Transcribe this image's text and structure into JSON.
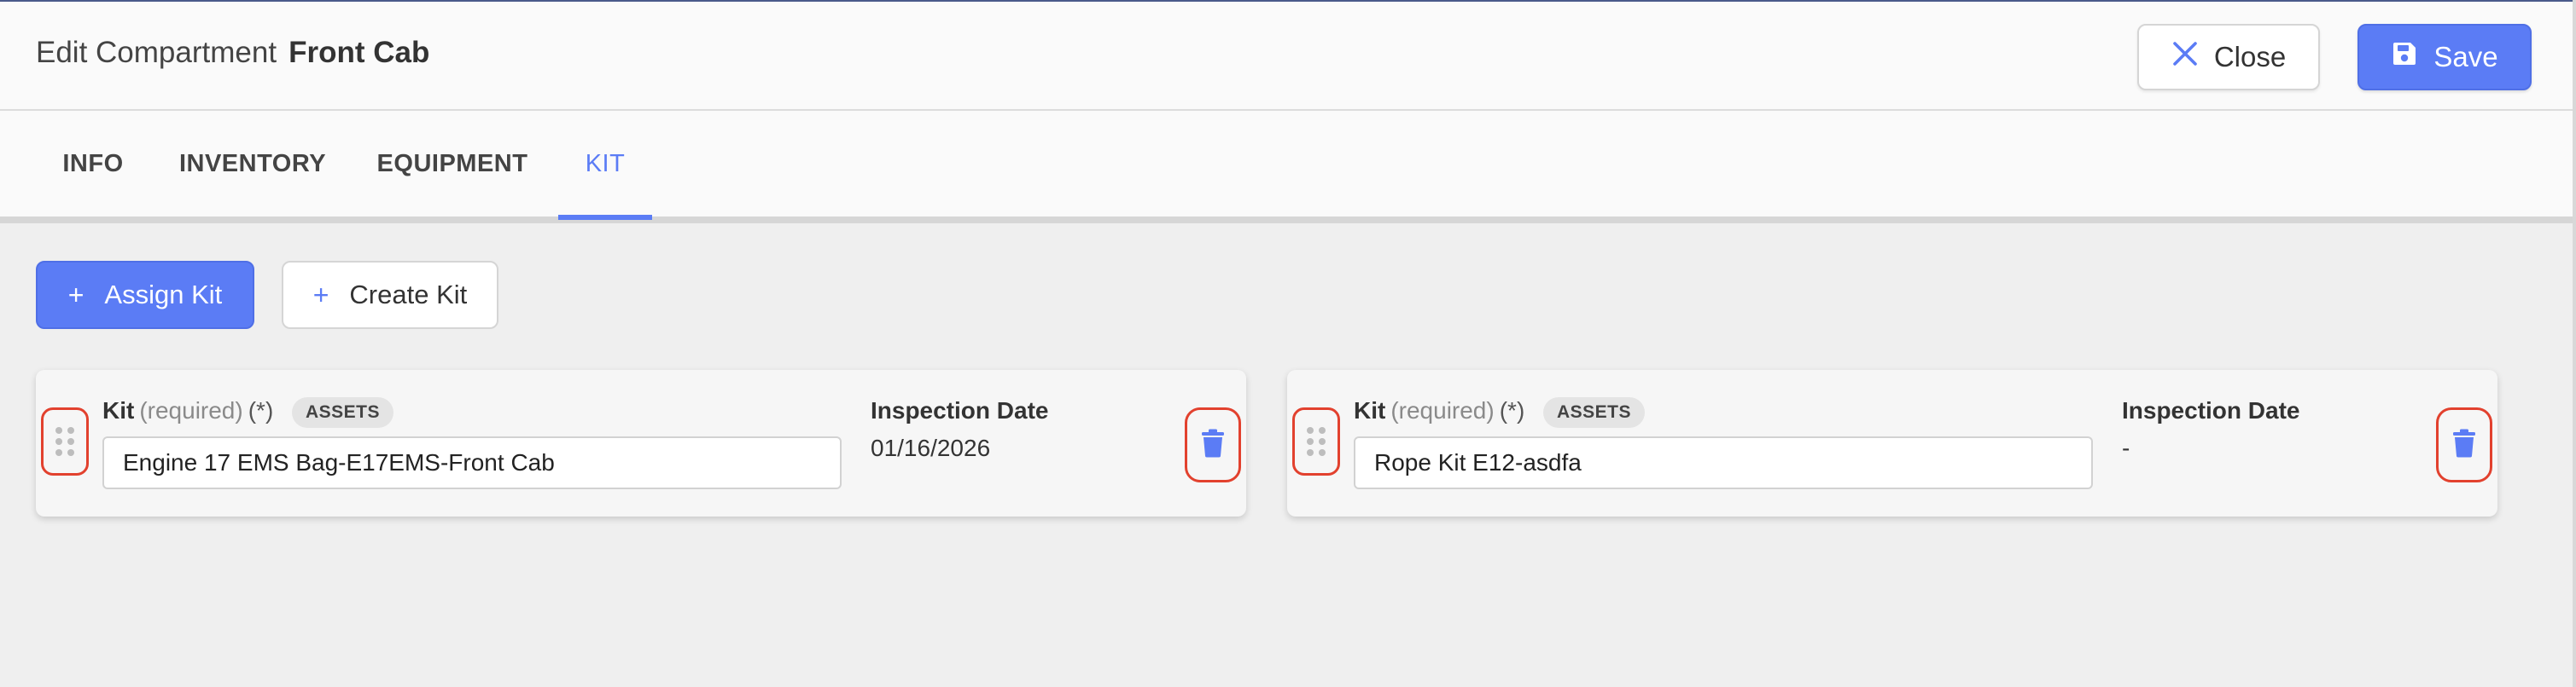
{
  "header": {
    "title_prefix": "Edit Compartment",
    "compartment_name": "Front Cab",
    "close_label": "Close",
    "save_label": "Save"
  },
  "tabs": [
    {
      "label": "INFO",
      "active": false
    },
    {
      "label": "INVENTORY",
      "active": false
    },
    {
      "label": "EQUIPMENT",
      "active": false
    },
    {
      "label": "KIT",
      "active": true
    }
  ],
  "actions": {
    "assign_kit_label": "Assign Kit",
    "create_kit_label": "Create Kit"
  },
  "kits": [
    {
      "field_label": "Kit",
      "required_text": "(required)",
      "required_marker": "(*)",
      "badge": "ASSETS",
      "value": "Engine 17 EMS Bag-E17EMS-Front Cab",
      "inspection_label": "Inspection Date",
      "inspection_date": "01/16/2026"
    },
    {
      "field_label": "Kit",
      "required_text": "(required)",
      "required_marker": "(*)",
      "badge": "ASSETS",
      "value": "Rope Kit E12-asdfa",
      "inspection_label": "Inspection Date",
      "inspection_date": "-"
    }
  ],
  "colors": {
    "accent": "#5b7cf5",
    "highlight_outline": "#e2412e",
    "background": "#efefef"
  },
  "icons": {
    "close": "close-icon",
    "save": "save-disk-icon",
    "add": "plus-icon",
    "drag": "drag-handle-icon",
    "delete": "trash-icon"
  }
}
